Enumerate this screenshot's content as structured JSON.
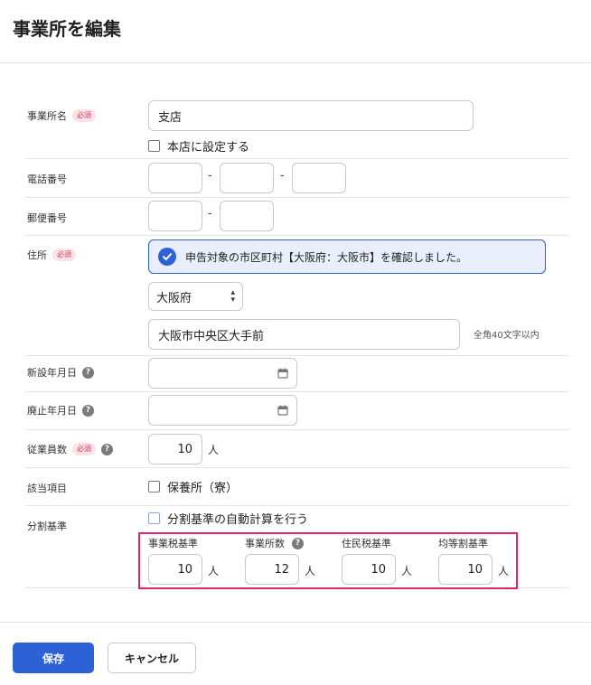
{
  "title": "事業所を編集",
  "required_badge": "必須",
  "help_glyph": "?",
  "fields": {
    "office_name": {
      "label": "事業所名",
      "value": "支店",
      "head_office_checkbox": "本店に設定する"
    },
    "phone": {
      "label": "電話番号",
      "dash": "-",
      "part1": "",
      "part2": "",
      "part3": ""
    },
    "postal": {
      "label": "郵便番号",
      "dash": "-",
      "part1": "",
      "part2": ""
    },
    "address": {
      "label": "住所",
      "notice": "申告対象の市区町村【大阪府：大阪市】を確認しました。",
      "prefecture": "大阪府",
      "street": "大阪市中央区大手前",
      "hint": "全角40文字以内"
    },
    "established": {
      "label": "新設年月日",
      "value": ""
    },
    "abolished": {
      "label": "廃止年月日",
      "value": ""
    },
    "employees": {
      "label": "従業員数",
      "value": "10",
      "unit": "人"
    },
    "category": {
      "label": "該当項目",
      "checkbox": "保養所（寮）"
    },
    "split": {
      "label": "分割基準",
      "auto_checkbox": "分割基準の自動計算を行う",
      "columns": [
        {
          "label": "事業税基準",
          "value": "10",
          "unit": "人"
        },
        {
          "label": "事業所数",
          "value": "12",
          "unit": "人"
        },
        {
          "label": "住民税基準",
          "value": "10",
          "unit": "人"
        },
        {
          "label": "均等割基準",
          "value": "10",
          "unit": "人"
        }
      ]
    }
  },
  "buttons": {
    "save": "保存",
    "cancel": "キャンセル"
  },
  "colors": {
    "primary": "#2c62d6",
    "highlight_border": "#e0246a",
    "required_badge_bg": "#fde3e8"
  }
}
